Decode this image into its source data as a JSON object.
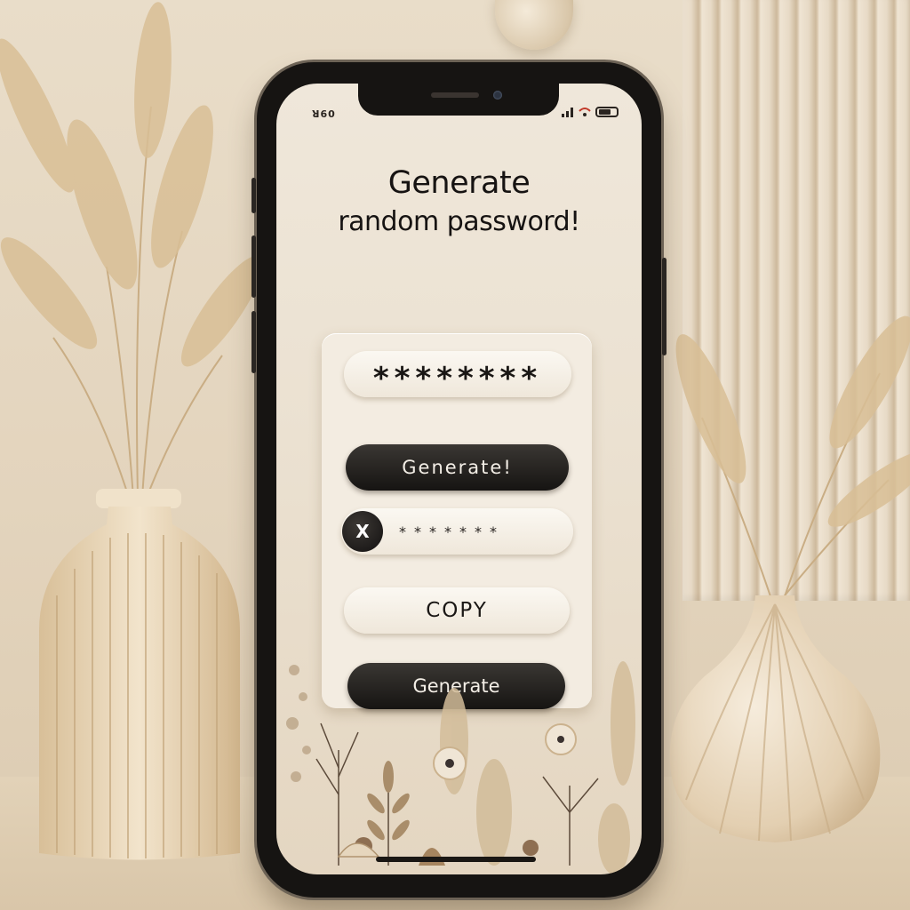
{
  "status_bar": {
    "left_text": "ꓤ60",
    "icons": [
      "signal-icon",
      "wifi-icon",
      "battery-icon"
    ]
  },
  "title": {
    "line1": "Generate",
    "line2": "random password!"
  },
  "password_field": {
    "value": "********"
  },
  "generate_top": {
    "label": "Generate!"
  },
  "masked_row": {
    "icon": "key-icon",
    "icon_glyph": "X",
    "value": "*******"
  },
  "copy_button": {
    "label": "COPY"
  },
  "generate_bottom": {
    "label": "Generate"
  },
  "colors": {
    "background": "#e6d9c4",
    "card": "#f3ece1",
    "dark_button": "#1e1b18",
    "phone_frame": "#161412"
  }
}
